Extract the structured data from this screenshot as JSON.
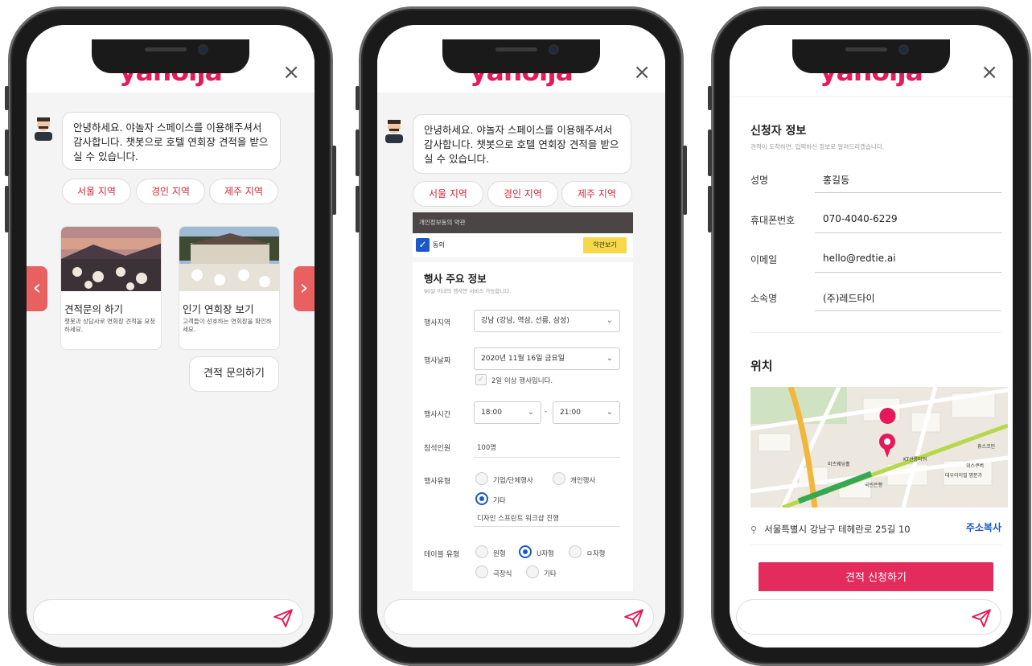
{
  "app": {
    "logo": "yanolja",
    "close": "×"
  },
  "colors": {
    "brand": "#e6195a",
    "chip_text": "#d0283b",
    "check": "#1b57c9",
    "agree_btn": "#f7d84a"
  },
  "chat": {
    "greeting": "안녕하세요. 야놀자 스페이스를 이용해주셔서 감사합니다. 챗봇으로 호텔 연회장 견적을 받으실 수 있습니다.",
    "chips": [
      "서울 지역",
      "경인 지역",
      "제주 지역"
    ],
    "cards": [
      {
        "title": "견적문의 하기",
        "desc": "챗봇과 상담사로 연회장 견적을 요청하세요."
      },
      {
        "title": "인기 연회장 보기",
        "desc": "고객들이 선호하는 연회장을 확인하세요."
      }
    ],
    "user_reply": "견적 문의하기"
  },
  "form": {
    "consent_bar": "개인정보동의 약관",
    "agree_label": "동의",
    "agree_button": "약관보기",
    "title": "행사 주요 정보",
    "subtitle": "90일 이내의 행사만 서비스 가능합니다.",
    "region_label": "행사지역",
    "region_value": "강남 (강남, 역삼, 선릉, 삼성)",
    "date_label": "행사날짜",
    "date_value": "2020년 11월 16일 금요일",
    "multi_day": "2일 이상 행사입니다.",
    "time_label": "행사시간",
    "time_start": "18:00",
    "time_sep": "-",
    "time_end": "21:00",
    "people_label": "참석인원",
    "people_value": "100명",
    "type_label": "행사유형",
    "type_options": [
      "기업/단체행사",
      "개인행사",
      "기타"
    ],
    "type_etc_value": "디자인 스프린트 워크샵 진행",
    "table_label": "테이블 유형",
    "table_options": [
      "원형",
      "U자형",
      "ㅁ자형",
      "극장식",
      "기타"
    ]
  },
  "applicant": {
    "title": "신청자 정보",
    "subtitle": "견적이 도착하면, 입력하신 정보로 알려드리겠습니다.",
    "fields": [
      {
        "label": "성명",
        "value": "홍길동"
      },
      {
        "label": "휴대폰번호",
        "value": "070-4040-6229"
      },
      {
        "label": "이메일",
        "value": "hello@redtie.ai"
      },
      {
        "label": "소속명",
        "value": "(주)레드타이"
      }
    ],
    "location_title": "위치",
    "address": "서울특별시 강남구 테헤란로 25길 10",
    "copy_address": "주소복사",
    "submit": "견적 신청하기",
    "map_labels": [
      "미츠웨딩홀",
      "KT선릉타워",
      "국민은행",
      "대우아이빌 명문가",
      "위스쿠버",
      "휴스코인"
    ]
  }
}
